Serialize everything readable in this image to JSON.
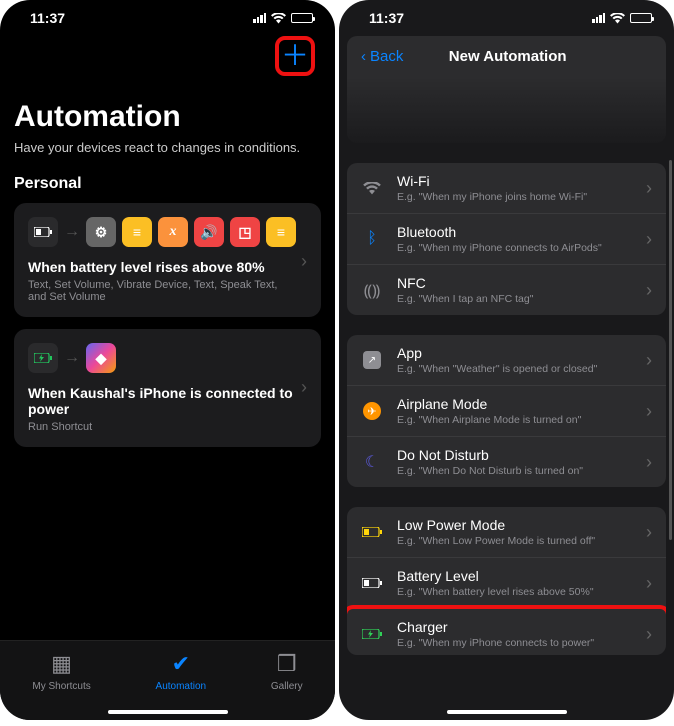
{
  "statusTime": "11:37",
  "left": {
    "pageTitle": "Automation",
    "subtitle": "Have your devices react to changes in conditions.",
    "section": "Personal",
    "automation1": {
      "title": "When battery level rises above 80%",
      "desc": "Text, Set Volume, Vibrate Device, Text, Speak Text, and Set Volume"
    },
    "automation2": {
      "title": "When Kaushal's iPhone is connected to power",
      "desc": "Run Shortcut"
    },
    "tabs": {
      "shortcuts": "My Shortcuts",
      "automation": "Automation",
      "gallery": "Gallery"
    }
  },
  "right": {
    "back": "Back",
    "title": "New Automation",
    "g1": [
      {
        "icon": "wifi",
        "label": "Wi-Fi",
        "ex": "E.g. \"When my iPhone joins home Wi-Fi\""
      },
      {
        "icon": "bluetooth",
        "label": "Bluetooth",
        "ex": "E.g. \"When my iPhone connects to AirPods\""
      },
      {
        "icon": "nfc",
        "label": "NFC",
        "ex": "E.g. \"When I tap an NFC tag\""
      }
    ],
    "g2": [
      {
        "icon": "app",
        "label": "App",
        "ex": "E.g. \"When \"Weather\" is opened or closed\""
      },
      {
        "icon": "airplane",
        "label": "Airplane Mode",
        "ex": "E.g. \"When Airplane Mode is turned on\""
      },
      {
        "icon": "dnd",
        "label": "Do Not Disturb",
        "ex": "E.g. \"When Do Not Disturb is turned on\""
      }
    ],
    "g3": [
      {
        "icon": "lowpower",
        "label": "Low Power Mode",
        "ex": "E.g. \"When Low Power Mode is turned off\""
      },
      {
        "icon": "battery",
        "label": "Battery Level",
        "ex": "E.g. \"When battery level rises above 50%\""
      },
      {
        "icon": "charger",
        "label": "Charger",
        "ex": "E.g. \"When my iPhone connects to power\""
      }
    ]
  }
}
